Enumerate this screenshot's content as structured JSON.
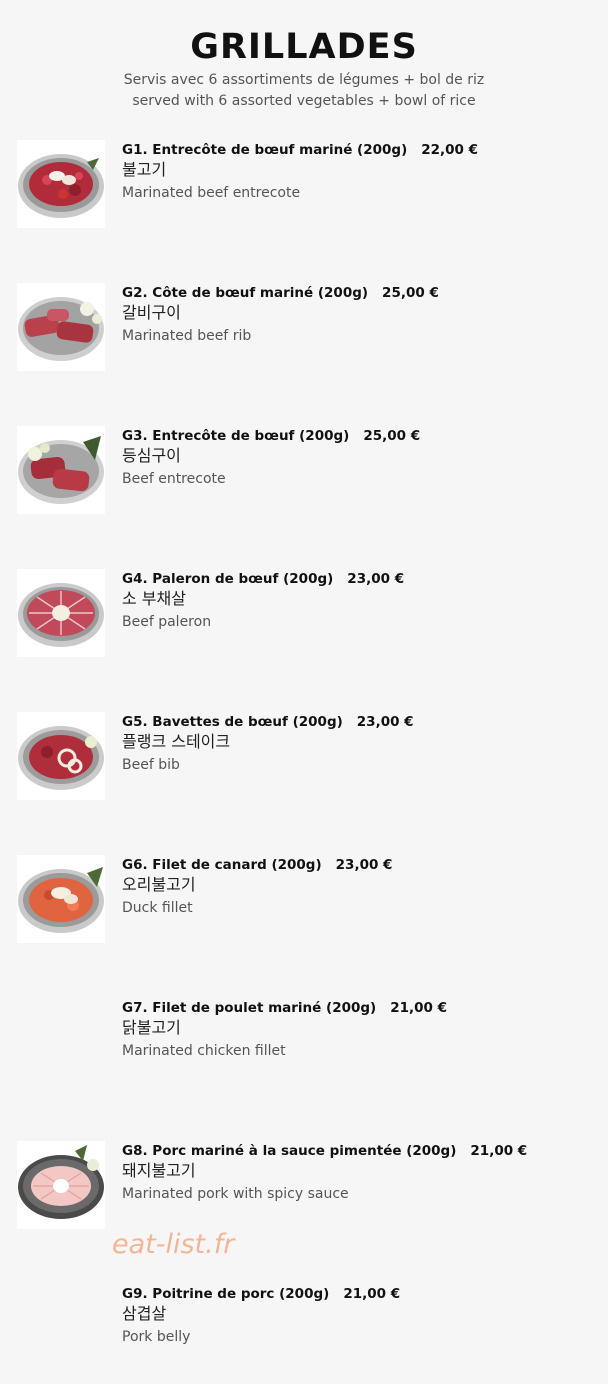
{
  "header": {
    "title": "GRILLADES",
    "subtitle_fr": "Servis avec 6 assortiments de légumes + bol de riz",
    "subtitle_en": "served with 6 assorted vegetables + bowl of rice"
  },
  "items": [
    {
      "name": "G1. Entrecôte de bœuf mariné (200g)",
      "price": "22,00 €",
      "korean": "불고기",
      "english": "Marinated beef entrecote",
      "has_image": true
    },
    {
      "name": "G2. Côte de bœuf mariné (200g)",
      "price": "25,00 €",
      "korean": "갈비구이",
      "english": "Marinated beef rib",
      "has_image": true
    },
    {
      "name": "G3. Entrecôte de bœuf (200g)",
      "price": "25,00 €",
      "korean": "등심구이",
      "english": "Beef entrecote",
      "has_image": true
    },
    {
      "name": "G4. Paleron de bœuf (200g)",
      "price": "23,00 €",
      "korean": "소 부채살",
      "english": "Beef paleron",
      "has_image": true
    },
    {
      "name": "G5. Bavettes de bœuf (200g)",
      "price": "23,00 €",
      "korean": "플랭크 스테이크",
      "english": "Beef bib",
      "has_image": true
    },
    {
      "name": "G6. Filet de canard (200g)",
      "price": "23,00 €",
      "korean": "오리불고기",
      "english": "Duck fillet",
      "has_image": true
    },
    {
      "name": "G7. Filet de poulet mariné (200g)",
      "price": "21,00 €",
      "korean": "닭불고기",
      "english": "Marinated chicken fillet",
      "has_image": false
    },
    {
      "name": "G8. Porc mariné à la sauce pimentée (200g)",
      "price": "21,00 €",
      "korean": "돼지불고기",
      "english": "Marinated pork with spicy sauce",
      "has_image": true
    },
    {
      "name": "G9. Poitrine de porc (200g)",
      "price": "21,00 €",
      "korean": "삼겹살",
      "english": "Pork belly",
      "has_image": false
    }
  ],
  "watermark": "eat-list.fr"
}
